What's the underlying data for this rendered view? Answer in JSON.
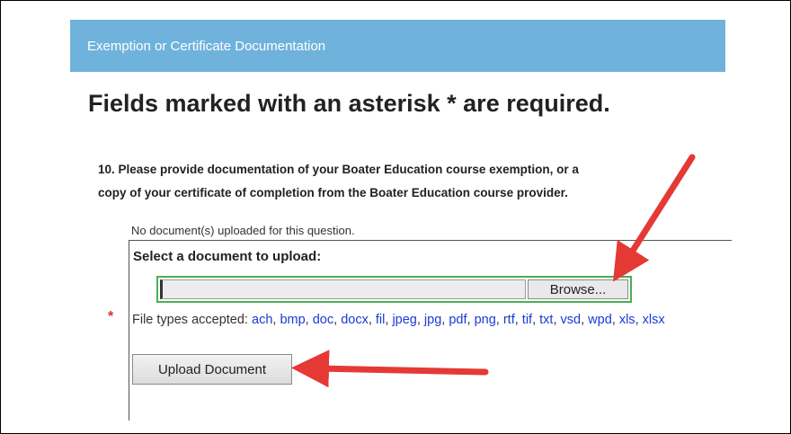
{
  "section": {
    "header_title": "Exemption or Certificate Documentation",
    "required_note": "Fields marked with an asterisk * are required."
  },
  "question": {
    "line1": "10. Please provide documentation of your Boater Education course exemption, or a",
    "line2": "copy of your certificate of completion from the Boater Education course provider."
  },
  "upload": {
    "status": "No document(s) uploaded for this question.",
    "select_label": "Select a document to upload:",
    "browse_label": "Browse...",
    "required_marker": "*",
    "file_types_label": "File types accepted:",
    "file_types": [
      "ach",
      "bmp",
      "doc",
      "docx",
      "fil",
      "jpeg",
      "jpg",
      "pdf",
      "png",
      "rtf",
      "tif",
      "txt",
      "vsd",
      "wpd",
      "xls",
      "xlsx"
    ],
    "upload_button_label": "Upload Document"
  },
  "colors": {
    "header_bg": "#6fb3dc",
    "link": "#1a3ad6",
    "highlight_border": "#4caf50",
    "arrow": "#e53935",
    "required_star": "#d32f2f"
  }
}
